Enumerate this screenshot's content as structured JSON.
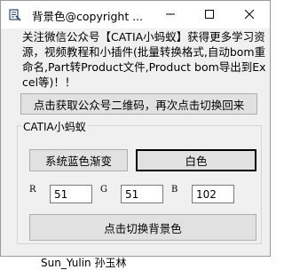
{
  "window": {
    "title": "背景色@copyright ..."
  },
  "description": "关注微信公众号【CATIA小蚂蚁】获得更多学习资源，视频教程和小插件(批量转换格式,自动bom重命名,Part转Product文件,Product bom导出到Excel等)！！",
  "qr_button_label": "点击获取公众号二维码，再次点击切换回来",
  "group": {
    "label": "CATIA小蚂蚁",
    "gradient_button_label": "系统蓝色渐变",
    "white_button_label": "白色",
    "r_label": "R",
    "g_label": "G",
    "b_label": "B",
    "r_value": "51",
    "g_value": "51",
    "b_value": "102",
    "switch_button_label": "点击切换背景色"
  },
  "background_status": "Sun_Yulin 孙玉林",
  "icons": {
    "app": "catia-app-icon",
    "minimize": "minimize-icon",
    "maximize": "maximize-icon",
    "close": "close-icon"
  }
}
